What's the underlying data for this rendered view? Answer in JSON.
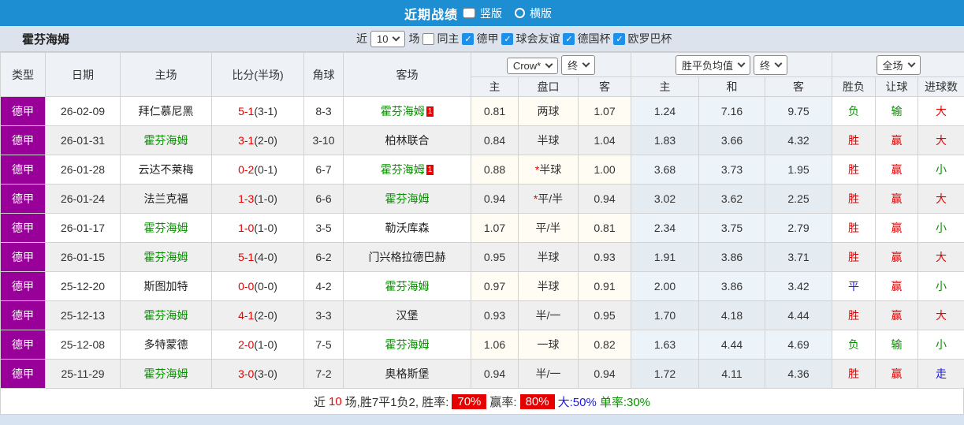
{
  "colors": {
    "accent_blue": "#1e8ed2",
    "type_purple": "#990099",
    "win_red": "#e60000",
    "lose_green": "#089000",
    "draw_blue": "#1a1ae6",
    "avg_col_bg": "#ecf4fa"
  },
  "topbar": {
    "title": "近期战绩",
    "radios": [
      {
        "label": "竖版",
        "selected": true
      },
      {
        "label": "横版",
        "selected": false
      }
    ]
  },
  "filterbar": {
    "team": "霍芬海姆",
    "near_label": "近",
    "matches_value": "10",
    "matches_suffix": "场",
    "checkboxes": [
      {
        "label": "同主",
        "checked": false
      },
      {
        "label": "德甲",
        "checked": true
      },
      {
        "label": "球会友谊",
        "checked": true
      },
      {
        "label": "德国杯",
        "checked": true
      },
      {
        "label": "欧罗巴杯",
        "checked": true
      }
    ]
  },
  "table": {
    "selects": {
      "bookmaker": "Crow*",
      "bookmaker_period": "终",
      "avg": "胜平负均值",
      "avg_period": "终",
      "scope": "全场"
    },
    "headers": {
      "type": "类型",
      "date": "日期",
      "home": "主场",
      "score": "比分(半场)",
      "corner": "角球",
      "away": "客场",
      "odds_home": "主",
      "odds_pan": "盘口",
      "odds_away": "客",
      "avg_home": "主",
      "avg_draw": "和",
      "avg_away": "客",
      "spf": "胜负",
      "rq": "让球",
      "jq": "进球数"
    },
    "rows": [
      {
        "type": "德甲",
        "date": "26-02-09",
        "home": {
          "text": "拜仁慕尼黑",
          "cls": "dark",
          "card": ""
        },
        "ft": "5-1",
        "ht": "(3-1)",
        "corner": "8-3",
        "away": {
          "text": "霍芬海姆",
          "cls": "green",
          "card": "1"
        },
        "crow_home": "0.81",
        "pan": {
          "star": "",
          "text": "两球"
        },
        "crow_away": "1.07",
        "avg_home": "1.24",
        "avg_draw": "7.16",
        "avg_away": "9.75",
        "spf": {
          "text": "负",
          "cls": "green"
        },
        "rq": {
          "text": "输",
          "cls": "green"
        },
        "jq": {
          "text": "大",
          "cls": "red"
        }
      },
      {
        "type": "德甲",
        "date": "26-01-31",
        "home": {
          "text": "霍芬海姆",
          "cls": "green",
          "card": ""
        },
        "ft": "3-1",
        "ht": "(2-0)",
        "corner": "3-10",
        "away": {
          "text": "柏林联合",
          "cls": "dark",
          "card": ""
        },
        "crow_home": "0.84",
        "pan": {
          "star": "",
          "text": "半球"
        },
        "crow_away": "1.04",
        "avg_home": "1.83",
        "avg_draw": "3.66",
        "avg_away": "4.32",
        "spf": {
          "text": "胜",
          "cls": "red"
        },
        "rq": {
          "text": "赢",
          "cls": "red"
        },
        "jq": {
          "text": "大",
          "cls": "red"
        }
      },
      {
        "type": "德甲",
        "date": "26-01-28",
        "home": {
          "text": "云达不莱梅",
          "cls": "dark",
          "card": ""
        },
        "ft": "0-2",
        "ht": "(0-1)",
        "corner": "6-7",
        "away": {
          "text": "霍芬海姆",
          "cls": "green",
          "card": "1"
        },
        "crow_home": "0.88",
        "pan": {
          "star": "*",
          "text": "半球"
        },
        "crow_away": "1.00",
        "avg_home": "3.68",
        "avg_draw": "3.73",
        "avg_away": "1.95",
        "spf": {
          "text": "胜",
          "cls": "red"
        },
        "rq": {
          "text": "赢",
          "cls": "red"
        },
        "jq": {
          "text": "小",
          "cls": "green"
        }
      },
      {
        "type": "德甲",
        "date": "26-01-24",
        "home": {
          "text": "法兰克福",
          "cls": "dark",
          "card": ""
        },
        "ft": "1-3",
        "ht": "(1-0)",
        "corner": "6-6",
        "away": {
          "text": "霍芬海姆",
          "cls": "green",
          "card": ""
        },
        "crow_home": "0.94",
        "pan": {
          "star": "*",
          "text": "平/半"
        },
        "crow_away": "0.94",
        "avg_home": "3.02",
        "avg_draw": "3.62",
        "avg_away": "2.25",
        "spf": {
          "text": "胜",
          "cls": "red"
        },
        "rq": {
          "text": "赢",
          "cls": "red"
        },
        "jq": {
          "text": "大",
          "cls": "red"
        }
      },
      {
        "type": "德甲",
        "date": "26-01-17",
        "home": {
          "text": "霍芬海姆",
          "cls": "green",
          "card": ""
        },
        "ft": "1-0",
        "ht": "(1-0)",
        "corner": "3-5",
        "away": {
          "text": "勒沃库森",
          "cls": "dark",
          "card": ""
        },
        "crow_home": "1.07",
        "pan": {
          "star": "",
          "text": "平/半"
        },
        "crow_away": "0.81",
        "avg_home": "2.34",
        "avg_draw": "3.75",
        "avg_away": "2.79",
        "spf": {
          "text": "胜",
          "cls": "red"
        },
        "rq": {
          "text": "赢",
          "cls": "red"
        },
        "jq": {
          "text": "小",
          "cls": "green"
        }
      },
      {
        "type": "德甲",
        "date": "26-01-15",
        "home": {
          "text": "霍芬海姆",
          "cls": "green",
          "card": ""
        },
        "ft": "5-1",
        "ht": "(4-0)",
        "corner": "6-2",
        "away": {
          "text": "门兴格拉德巴赫",
          "cls": "dark",
          "card": ""
        },
        "crow_home": "0.95",
        "pan": {
          "star": "",
          "text": "半球"
        },
        "crow_away": "0.93",
        "avg_home": "1.91",
        "avg_draw": "3.86",
        "avg_away": "3.71",
        "spf": {
          "text": "胜",
          "cls": "red"
        },
        "rq": {
          "text": "赢",
          "cls": "red"
        },
        "jq": {
          "text": "大",
          "cls": "red"
        }
      },
      {
        "type": "德甲",
        "date": "25-12-20",
        "home": {
          "text": "斯图加特",
          "cls": "dark",
          "card": ""
        },
        "ft": "0-0",
        "ht": "(0-0)",
        "corner": "4-2",
        "away": {
          "text": "霍芬海姆",
          "cls": "green",
          "card": ""
        },
        "crow_home": "0.97",
        "pan": {
          "star": "",
          "text": "半球"
        },
        "crow_away": "0.91",
        "avg_home": "2.00",
        "avg_draw": "3.86",
        "avg_away": "3.42",
        "spf": {
          "text": "平",
          "cls": "blue"
        },
        "rq": {
          "text": "赢",
          "cls": "red"
        },
        "jq": {
          "text": "小",
          "cls": "green"
        }
      },
      {
        "type": "德甲",
        "date": "25-12-13",
        "home": {
          "text": "霍芬海姆",
          "cls": "green",
          "card": ""
        },
        "ft": "4-1",
        "ht": "(2-0)",
        "corner": "3-3",
        "away": {
          "text": "汉堡",
          "cls": "dark",
          "card": ""
        },
        "crow_home": "0.93",
        "pan": {
          "star": "",
          "text": "半/一"
        },
        "crow_away": "0.95",
        "avg_home": "1.70",
        "avg_draw": "4.18",
        "avg_away": "4.44",
        "spf": {
          "text": "胜",
          "cls": "red"
        },
        "rq": {
          "text": "赢",
          "cls": "red"
        },
        "jq": {
          "text": "大",
          "cls": "red"
        }
      },
      {
        "type": "德甲",
        "date": "25-12-08",
        "home": {
          "text": "多特蒙德",
          "cls": "dark",
          "card": ""
        },
        "ft": "2-0",
        "ht": "(1-0)",
        "corner": "7-5",
        "away": {
          "text": "霍芬海姆",
          "cls": "green",
          "card": ""
        },
        "crow_home": "1.06",
        "pan": {
          "star": "",
          "text": "一球"
        },
        "crow_away": "0.82",
        "avg_home": "1.63",
        "avg_draw": "4.44",
        "avg_away": "4.69",
        "spf": {
          "text": "负",
          "cls": "green"
        },
        "rq": {
          "text": "输",
          "cls": "green"
        },
        "jq": {
          "text": "小",
          "cls": "green"
        }
      },
      {
        "type": "德甲",
        "date": "25-11-29",
        "home": {
          "text": "霍芬海姆",
          "cls": "green",
          "card": ""
        },
        "ft": "3-0",
        "ht": "(3-0)",
        "corner": "7-2",
        "away": {
          "text": "奥格斯堡",
          "cls": "dark",
          "card": ""
        },
        "crow_home": "0.94",
        "pan": {
          "star": "",
          "text": "半/一"
        },
        "crow_away": "0.94",
        "avg_home": "1.72",
        "avg_draw": "4.11",
        "avg_away": "4.36",
        "spf": {
          "text": "胜",
          "cls": "red"
        },
        "rq": {
          "text": "赢",
          "cls": "red"
        },
        "jq": {
          "text": "走",
          "cls": "blue"
        }
      }
    ]
  },
  "summary": {
    "prefix": "近",
    "count": "10",
    "record_text": "场,胜7平1负2, 胜率:",
    "win_rate": "70%",
    "profit_label": "赢率:",
    "profit_rate": "80%",
    "big_text": "大:50%",
    "single_text": "单率:30%"
  }
}
